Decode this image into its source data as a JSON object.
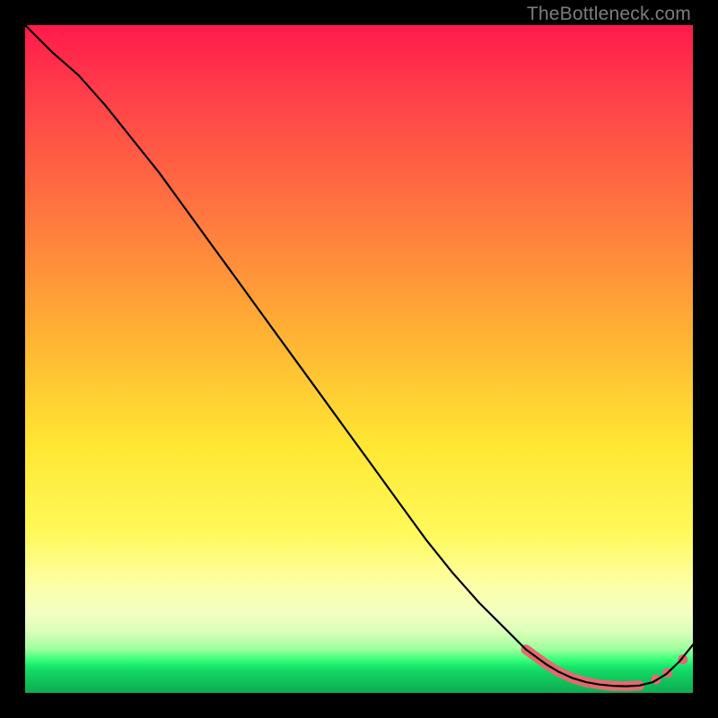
{
  "watermark": "TheBottleneck.com",
  "colors": {
    "marker": "#e46a6f",
    "curve": "#000000"
  },
  "chart_data": {
    "type": "line",
    "title": "",
    "xlabel": "",
    "ylabel": "",
    "xlim": [
      0,
      100
    ],
    "ylim": [
      0,
      100
    ],
    "grid": false,
    "legend": false,
    "series": [
      {
        "name": "bottleneck-curve",
        "x": [
          0,
          4,
          8,
          12,
          16,
          20,
          24,
          28,
          32,
          36,
          40,
          44,
          48,
          52,
          56,
          60,
          64,
          68,
          72,
          75,
          78,
          80,
          82,
          84,
          86,
          88,
          90,
          92,
          94,
          96,
          98,
          100
        ],
        "y": [
          100,
          96,
          92.5,
          88,
          83,
          78,
          72.5,
          67,
          61.5,
          56,
          50.5,
          45,
          39.5,
          34,
          28.5,
          23,
          18,
          13.5,
          9.5,
          6.5,
          4.3,
          3.1,
          2.2,
          1.6,
          1.25,
          1.05,
          1.0,
          1.1,
          1.6,
          2.8,
          4.7,
          7.2
        ]
      }
    ],
    "markers": {
      "band": {
        "x_start": 75,
        "x_end": 92,
        "note": "dense pink marker cluster along curve bottom"
      },
      "dots": [
        {
          "x": 94.5,
          "y": 2.0
        },
        {
          "x": 96.2,
          "y": 3.0
        },
        {
          "x": 98.5,
          "y": 5.0
        }
      ]
    },
    "gradient_stops": [
      {
        "pos": 0.0,
        "color": "#ff1a4b"
      },
      {
        "pos": 0.3,
        "color": "#ff7c3e"
      },
      {
        "pos": 0.63,
        "color": "#ffe733"
      },
      {
        "pos": 0.88,
        "color": "#f3ffc2"
      },
      {
        "pos": 0.95,
        "color": "#3bff7a"
      },
      {
        "pos": 1.0,
        "color": "#0eae52"
      }
    ]
  }
}
